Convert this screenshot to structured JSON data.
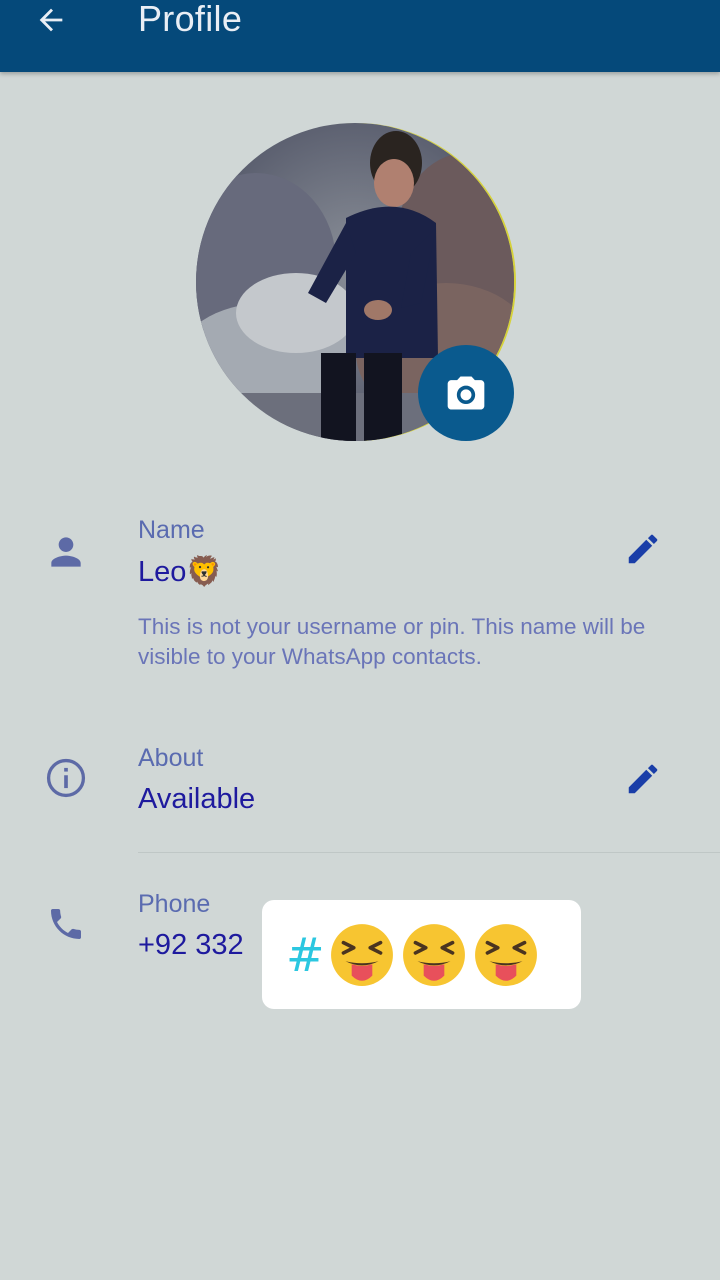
{
  "appbar": {
    "title": "Profile",
    "back_icon": "arrow-left-icon"
  },
  "profile_photo": {
    "camera_icon": "camera-icon"
  },
  "name_section": {
    "label": "Name",
    "value": "Leo🦁",
    "hint": "This is not your username or pin. This name will be visible to your WhatsApp contacts.",
    "icon": "person-icon",
    "edit_icon": "pencil-icon"
  },
  "about_section": {
    "label": "About",
    "value": "Available",
    "icon": "info-icon",
    "edit_icon": "pencil-icon"
  },
  "phone_section": {
    "label": "Phone",
    "value": "+92 332",
    "icon": "phone-icon"
  },
  "sticker_overlay": {
    "hash": "#",
    "emoji_count": 3,
    "emoji": "squinting-face-with-tongue"
  },
  "colors": {
    "appbar": "#05497a",
    "background": "#d0d7d6",
    "accent": "#1e1a9e",
    "camera_button": "#0a5a8e"
  }
}
